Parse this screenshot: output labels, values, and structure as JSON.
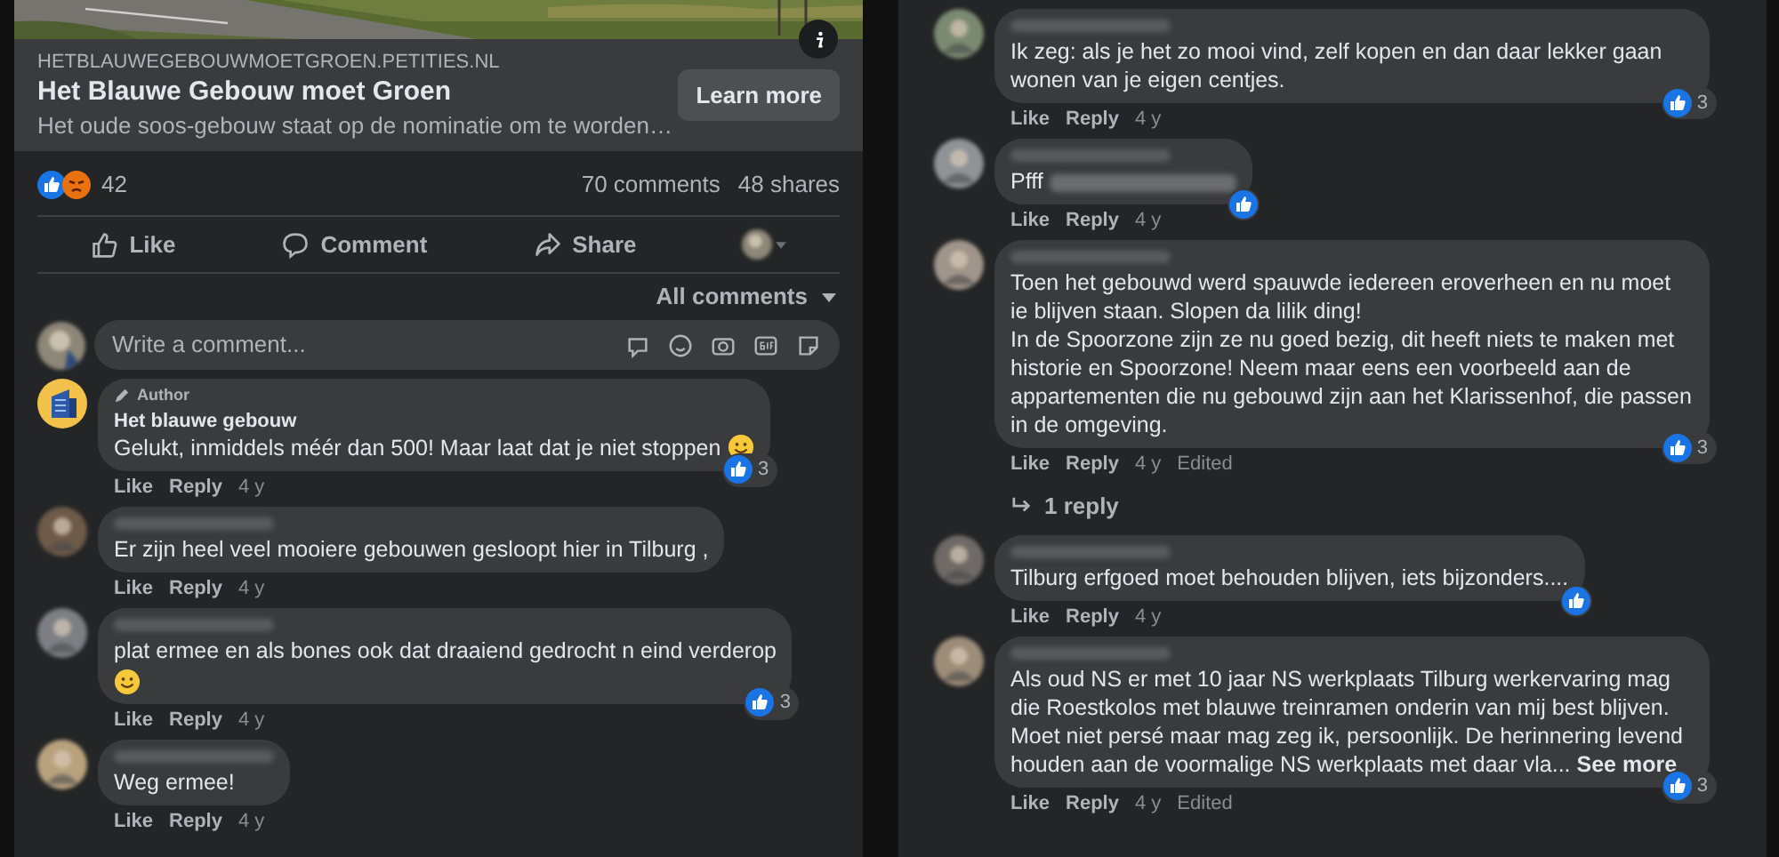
{
  "link_preview": {
    "domain": "HETBLAUWEGEBOUWMOETGROEN.PETITIES.NL",
    "title": "Het Blauwe Gebouw moet Groen",
    "description": "Het oude soos-gebouw staat op de nominatie om te worden…",
    "button": "Learn more"
  },
  "reactions": {
    "count": "42"
  },
  "stats": {
    "comments": "70 comments",
    "shares": "48 shares"
  },
  "actions": [
    {
      "kind": "like",
      "label": "Like"
    },
    {
      "kind": "comment",
      "label": "Comment"
    },
    {
      "kind": "share",
      "label": "Share"
    }
  ],
  "filter": "All comments",
  "composer": {
    "placeholder": "Write a comment..."
  },
  "left_comments": [
    {
      "kind": "author",
      "badge": "Author",
      "author": "Het blauwe gebouw",
      "text": "Gelukt, inmiddels méér dan 500! Maar laat dat je niet stoppen",
      "ends_with_emoji": true,
      "meta": [
        "Like",
        "Reply",
        "4 y"
      ],
      "reacted": true,
      "reaction_count": "3"
    },
    {
      "kind": "user",
      "text": "Er zijn heel veel mooiere gebouwen gesloopt hier in Tilburg ,",
      "meta": [
        "Like",
        "Reply",
        "4 y"
      ],
      "reacted": false
    },
    {
      "kind": "user",
      "text": "plat ermee en als bones ook dat draaiend gedrocht n eind verderop",
      "ends_with_emoji": true,
      "emoji_own_line": true,
      "meta": [
        "Like",
        "Reply",
        "4 y"
      ],
      "reacted": true,
      "reaction_count": "3"
    },
    {
      "kind": "user",
      "text": "Weg ermee!",
      "meta": [
        "Like",
        "Reply",
        "4 y"
      ],
      "reacted": false
    }
  ],
  "right_comments": [
    {
      "kind": "user",
      "text": "Ik zeg: als je het zo mooi vind, zelf kopen en dan daar lekker gaan wonen van je eigen centjes.",
      "meta": [
        "Like",
        "Reply",
        "4 y"
      ],
      "reacted": true,
      "reaction_count": "3"
    },
    {
      "kind": "user",
      "text": "Pfff",
      "mention_redacted": true,
      "meta": [
        "Like",
        "Reply",
        "4 y"
      ],
      "reacted": true
    },
    {
      "kind": "user",
      "text": "Toen het gebouwd werd spauwde iedereen eroverheen en nu moet ie blijven staan. Slopen da lilik ding!\nIn de Spoorzone zijn ze nu goed bezig, dit heeft niets te maken met historie en Spoorzone! Neem maar eens een voorbeeld aan de appartementen die nu gebouwd zijn aan het Klarissenhof, die passen in de omgeving.",
      "meta": [
        "Like",
        "Reply",
        "4 y",
        "Edited"
      ],
      "reacted": true,
      "reaction_count": "3",
      "replies": "1 reply"
    },
    {
      "kind": "user",
      "text": "Tilburg erfgoed moet behouden blijven, iets bijzonders....",
      "meta": [
        "Like",
        "Reply",
        "4 y"
      ],
      "reacted": true
    },
    {
      "kind": "user",
      "text": "Als oud NS er met 10 jaar NS werkplaats Tilburg werkervaring mag die Roestkolos met blauwe treinramen onderin van mij best blijven. Moet niet persé maar mag zeg ik, persoonlijk. De herinnering levend houden aan de voormalige NS werkplaats met daar vla...",
      "see_more": "See more",
      "meta": [
        "Like",
        "Reply",
        "4 y",
        "Edited"
      ],
      "reacted": true,
      "reaction_count": "3"
    }
  ]
}
